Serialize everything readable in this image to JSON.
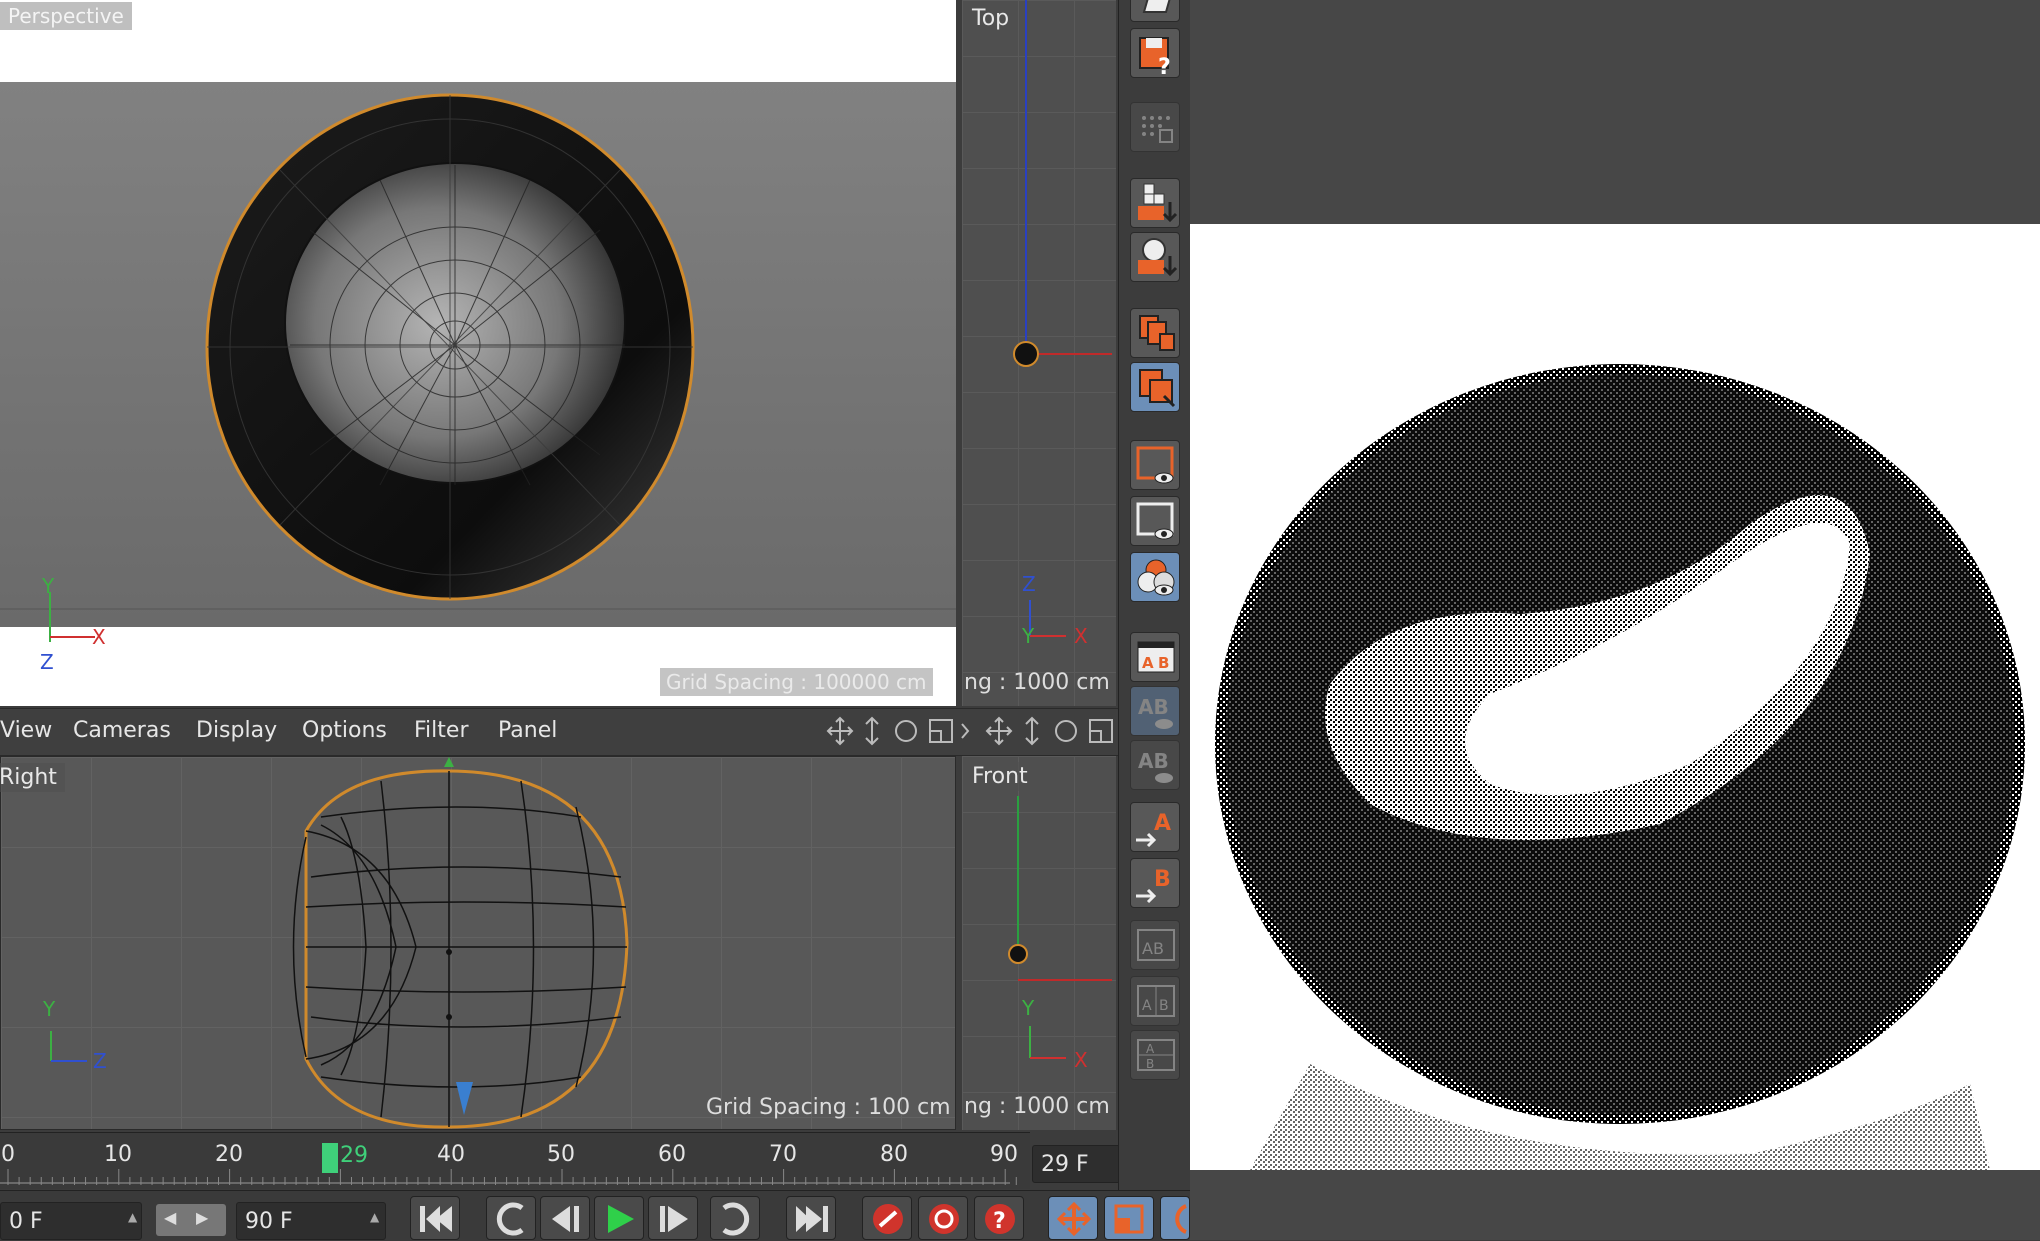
{
  "perspective_view": {
    "label": "Perspective",
    "grid_spacing": "Grid Spacing : 100000 cm"
  },
  "top_view": {
    "label": "Top",
    "grid_spacing": "ng : 1000 cm"
  },
  "right_view": {
    "label": "Right",
    "grid_spacing": "Grid Spacing : 100 cm"
  },
  "front_view": {
    "label": "Front",
    "grid_spacing": "ng : 1000 cm"
  },
  "menu": {
    "view": "View",
    "cameras": "Cameras",
    "display": "Display",
    "options": "Options",
    "filter": "Filter",
    "panel": "Panel"
  },
  "axes": {
    "x": "X",
    "y": "Y",
    "z": "Z"
  },
  "timeline": {
    "ticks": [
      "0",
      "10",
      "20",
      "40",
      "50",
      "60",
      "70",
      "80",
      "90"
    ],
    "current_frame_marker": "29",
    "current_frame_field": "29 F",
    "start_field": "0 F",
    "end_field": "90 F"
  },
  "colors": {
    "accent_orange": "#e8632a",
    "selection_outline": "#d08a2c",
    "axis_x": "#d03030",
    "axis_y": "#3cb043",
    "axis_z": "#3050d0",
    "marker_green": "#3fd07a"
  },
  "icons": [
    "grid-icon",
    "save-help-icon",
    "dots-grid-icon",
    "render-region-icon",
    "render-object-icon",
    "render-delete-icon",
    "render-copy-icon",
    "frame-view-icon",
    "frame-eye-icon",
    "eye-circles-icon",
    "ab-icon",
    "ab-eye-icon",
    "ab-dim-icon",
    "a-arrow-icon",
    "b-arrow-icon",
    "ab-swap-icon",
    "ab-split-icon",
    "ab-compare-icon"
  ]
}
